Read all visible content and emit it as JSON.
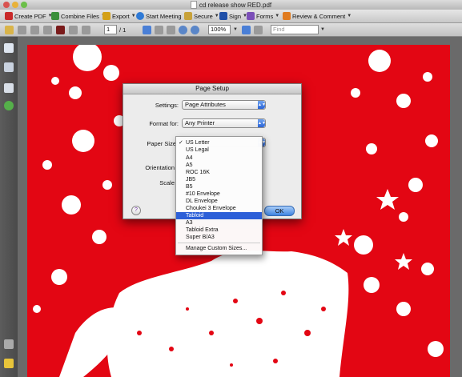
{
  "window": {
    "title": "cd release show RED.pdf"
  },
  "toolbar": {
    "create_pdf": "Create PDF",
    "combine_files": "Combine Files",
    "export": "Export",
    "start_meeting": "Start Meeting",
    "secure": "Secure",
    "sign": "Sign",
    "forms": "Forms",
    "review_comment": "Review & Comment"
  },
  "nav_toolbar": {
    "page_number": "1",
    "page_total": "/ 1",
    "zoom": "100%",
    "find_placeholder": "Find"
  },
  "dialog": {
    "title": "Page Setup",
    "settings_label": "Settings:",
    "settings_value": "Page Attributes",
    "format_label": "Format for:",
    "format_value": "Any Printer",
    "paper_size_label": "Paper Size",
    "orientation_label": "Orientation",
    "scale_label": "Scale",
    "ok_label": "OK",
    "help_label": "?"
  },
  "paper_menu": {
    "items": [
      "US Letter",
      "US Legal",
      "A4",
      "A5",
      "ROC 16K",
      "JB5",
      "B5",
      "#10 Envelope",
      "DL Envelope",
      "Choukei 3 Envelope",
      "Tabloid",
      "A3",
      "Tabloid Extra",
      "Super B/A3"
    ],
    "checked_item": "US Letter",
    "selected_item": "Tabloid",
    "manage_label": "Manage Custom Sizes..."
  },
  "colors": {
    "page_red": "#e30613",
    "menu_highlight": "#2c5fd8"
  }
}
